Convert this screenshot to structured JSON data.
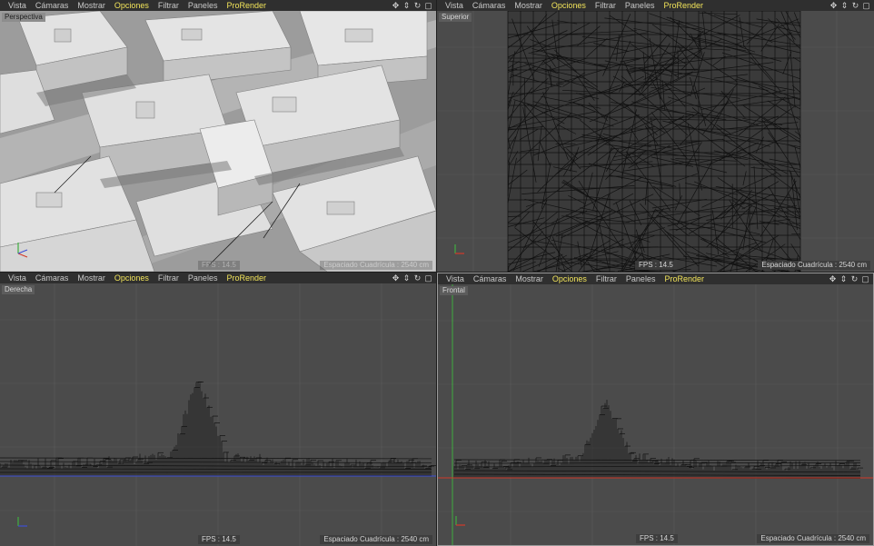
{
  "menu": [
    "Vista",
    "Cámaras",
    "Mostrar",
    "Opciones",
    "Filtrar",
    "Paneles",
    "ProRender"
  ],
  "viewports": {
    "perspective": {
      "label": "Perspectiva",
      "fps": "FPS : 14.5",
      "grid": "Espaciado Cuadrícula : 2540 cm"
    },
    "top": {
      "label": "Superior",
      "fps": "FPS : 14.5",
      "grid": "Espaciado Cuadrícula : 2540 cm"
    },
    "right": {
      "label": "Derecha",
      "fps": "FPS : 14.5",
      "grid": "Espaciado Cuadrícula : 2540 cm"
    },
    "front": {
      "label": "Frontal",
      "fps": "FPS : 14.5",
      "grid": "Espaciado Cuadrícula : 2540 cm"
    }
  },
  "nav_icons": [
    "move-icon",
    "zoom-icon",
    "rotate-icon",
    "maximize-icon"
  ],
  "colors": {
    "highlight": "#f2e45a",
    "axis_x": "#d23a2a",
    "axis_y": "#3fae3f",
    "axis_z": "#3c4fd6"
  }
}
